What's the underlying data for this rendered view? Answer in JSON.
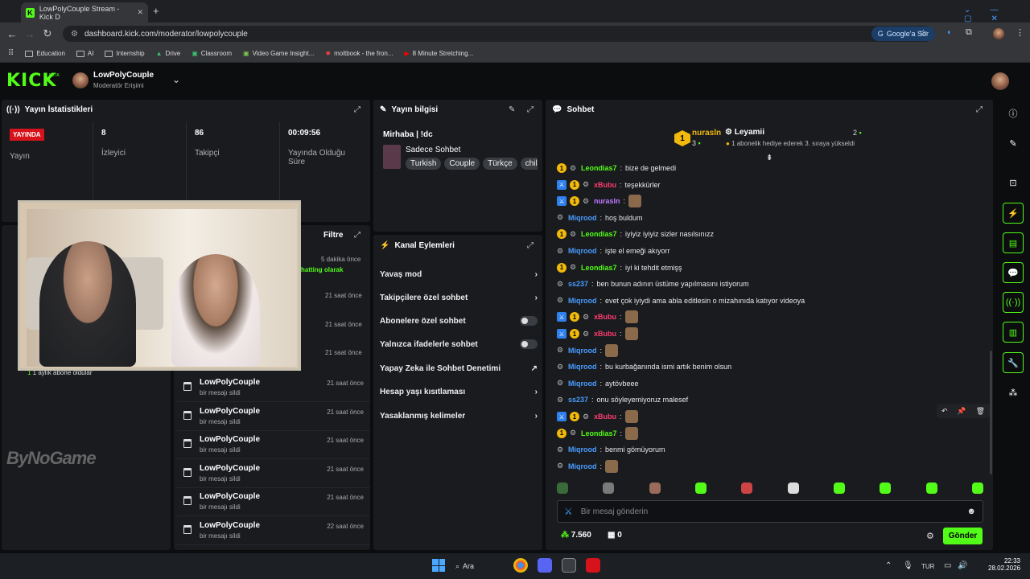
{
  "browser": {
    "tab_title": "LowPolyCouple Stream - Kick D",
    "url": "dashboard.kick.com/moderator/lowpolycouple",
    "google_btn": "Google'a Sor",
    "bookmarks": [
      "Education",
      "AI",
      "Internship",
      "Drive",
      "Classroom",
      "Video Game Insight...",
      "moltbook - the fron...",
      "8 Minute Stretching..."
    ]
  },
  "header": {
    "logo": "KICK",
    "beta": "BETA",
    "channel": "LowPolyCouple",
    "role": "Moderatör Erişimi"
  },
  "stats": {
    "title": "Yayın İstatistikleri",
    "live_badge": "YAYINDA",
    "live_label": "Yayın",
    "viewers": "8",
    "viewers_label": "İzleyici",
    "followers": "86",
    "followers_label": "Takipçi",
    "uptime": "00:09:56",
    "uptime_label": "Yayında Olduğu Süre"
  },
  "streaminfo": {
    "title": "Yayın bilgisi",
    "stream_title": "Mirhaba | !dc",
    "category": "Sadece Sohbet",
    "tags": [
      "Turkish",
      "Couple",
      "Türkçe",
      "chil"
    ]
  },
  "actions": {
    "title": "Kanal Eylemleri",
    "items": [
      "Yavaş mod",
      "Takipçilere özel sohbet",
      "Abonelere özel sohbet",
      "Yalnızca ifadelerle sohbet",
      "Yapay Zeka ile Sohbet Denetimi",
      "Hesap yaşı kısıtlaması",
      "Yasaklanmış kelimeler"
    ]
  },
  "activity": {
    "sub_text": "1 aylık abone oldular",
    "chatting": "hatting olarak",
    "t0": "5 dakika önce",
    "watermark": "ByNoGame"
  },
  "modlog": {
    "filter": "Filtre",
    "partial_times": [
      "21 saat önce",
      "21 saat önce",
      "21 saat önce"
    ],
    "rows": [
      {
        "name": "LowPolyCouple",
        "sub": "bir mesajı sildi",
        "time": "21 saat önce"
      },
      {
        "name": "LowPolyCouple",
        "sub": "bir mesajı sildi",
        "time": "21 saat önce"
      },
      {
        "name": "LowPolyCouple",
        "sub": "bir mesajı sildi",
        "time": "21 saat önce"
      },
      {
        "name": "LowPolyCouple",
        "sub": "bir mesajı sildi",
        "time": "21 saat önce"
      },
      {
        "name": "LowPolyCouple",
        "sub": "bir mesajı sildi",
        "time": "21 saat önce"
      },
      {
        "name": "LowPolyCouple",
        "sub": "bir mesajı sildi",
        "time": "22 saat önce"
      }
    ]
  },
  "chat": {
    "title": "Sohbet",
    "top_user": "nurasln",
    "top_count": "3",
    "rank1": "1",
    "second_user": "Leyamii",
    "second_count": "2",
    "pinned": "1 abonelik hediye ederek 3. sıraya yükseldi",
    "messages": [
      {
        "user": "Leondias7",
        "color": "#53fc18",
        "text": "bize de gelmedi"
      },
      {
        "user": "xBubu",
        "color": "#ff3c6e",
        "text": "teşekkürler"
      },
      {
        "user": "nurasln",
        "color": "#c07aff",
        "text": ""
      },
      {
        "user": "Miqrood",
        "color": "#4a9dff",
        "text": "hoş buldum"
      },
      {
        "user": "Leondias7",
        "color": "#53fc18",
        "text": "iyiyiz iyiyiz sizler nasılsınızz"
      },
      {
        "user": "Miqrood",
        "color": "#4a9dff",
        "text": "işte el emeği akıyorr"
      },
      {
        "user": "Leondias7",
        "color": "#53fc18",
        "text": "iyi ki tehdit etmişş"
      },
      {
        "user": "ss237",
        "color": "#4a9dff",
        "text": "ben bunun adının üstüme yapılmasını istiyorum"
      },
      {
        "user": "Miqrood",
        "color": "#4a9dff",
        "text": "evet çok iyiydi ama abla editlesin o mizahınıda katıyor videoya"
      },
      {
        "user": "xBubu",
        "color": "#ff3c6e",
        "text": ""
      },
      {
        "user": "xBubu",
        "color": "#ff3c6e",
        "text": ""
      },
      {
        "user": "Miqrood",
        "color": "#4a9dff",
        "text": ""
      },
      {
        "user": "Miqrood",
        "color": "#4a9dff",
        "text": "bu kurbağanında ismi artık benim olsun"
      },
      {
        "user": "Miqrood",
        "color": "#4a9dff",
        "text": "aytövbeee"
      },
      {
        "user": "ss237",
        "color": "#4a9dff",
        "text": "onu söyleyemiyoruz malesef"
      },
      {
        "user": "xBubu",
        "color": "#ff3c6e",
        "text": ""
      },
      {
        "user": "Leondias7",
        "color": "#53fc18",
        "text": ""
      },
      {
        "user": "Miqrood",
        "color": "#4a9dff",
        "text": "benmi gömüyorum"
      },
      {
        "user": "Miqrood",
        "color": "#4a9dff",
        "text": ""
      }
    ],
    "input_placeholder": "Bir mesaj gönderin",
    "points": "7.560",
    "gifts": "0",
    "send": "Gönder"
  },
  "taskbar": {
    "search": "Ara",
    "lang": "TUR",
    "time": "22:33",
    "date": "28.02.2026"
  }
}
